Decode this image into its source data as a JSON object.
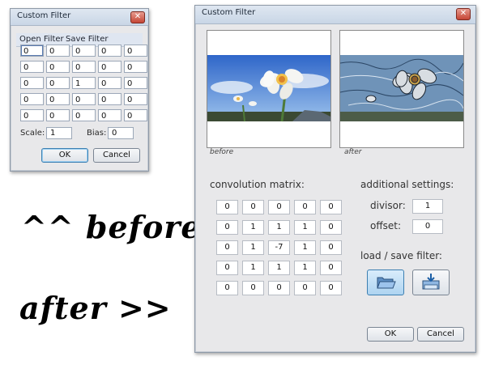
{
  "small_dialog": {
    "title": "Custom Filter",
    "close": "✕",
    "menu": [
      "Open Filter",
      "Save Filter"
    ],
    "matrix": [
      [
        "0",
        "0",
        "0",
        "0",
        "0"
      ],
      [
        "0",
        "0",
        "0",
        "0",
        "0"
      ],
      [
        "0",
        "0",
        "1",
        "0",
        "0"
      ],
      [
        "0",
        "0",
        "0",
        "0",
        "0"
      ],
      [
        "0",
        "0",
        "0",
        "0",
        "0"
      ]
    ],
    "scale_label": "Scale:",
    "scale_value": "1",
    "bias_label": "Bias:",
    "bias_value": "0",
    "ok": "OK",
    "cancel": "Cancel"
  },
  "annotations": {
    "before": "^^ before",
    "after": "after >>"
  },
  "large_dialog": {
    "title": "Custom Filter",
    "close": "✕",
    "before_caption": "before",
    "after_caption": "after",
    "convolution_label": "convolution matrix:",
    "matrix": [
      [
        "0",
        "0",
        "0",
        "0",
        "0"
      ],
      [
        "0",
        "1",
        "1",
        "1",
        "0"
      ],
      [
        "0",
        "1",
        "-7",
        "1",
        "0"
      ],
      [
        "0",
        "1",
        "1",
        "1",
        "0"
      ],
      [
        "0",
        "0",
        "0",
        "0",
        "0"
      ]
    ],
    "additional_label": "additional settings:",
    "divisor_label": "divisor:",
    "divisor_value": "1",
    "offset_label": "offset:",
    "offset_value": "0",
    "load_save_label": "load / save filter:",
    "ok": "OK",
    "cancel": "Cancel"
  },
  "icons": {
    "close": "close-icon",
    "open_folder": "open-folder-icon",
    "save": "save-icon"
  }
}
